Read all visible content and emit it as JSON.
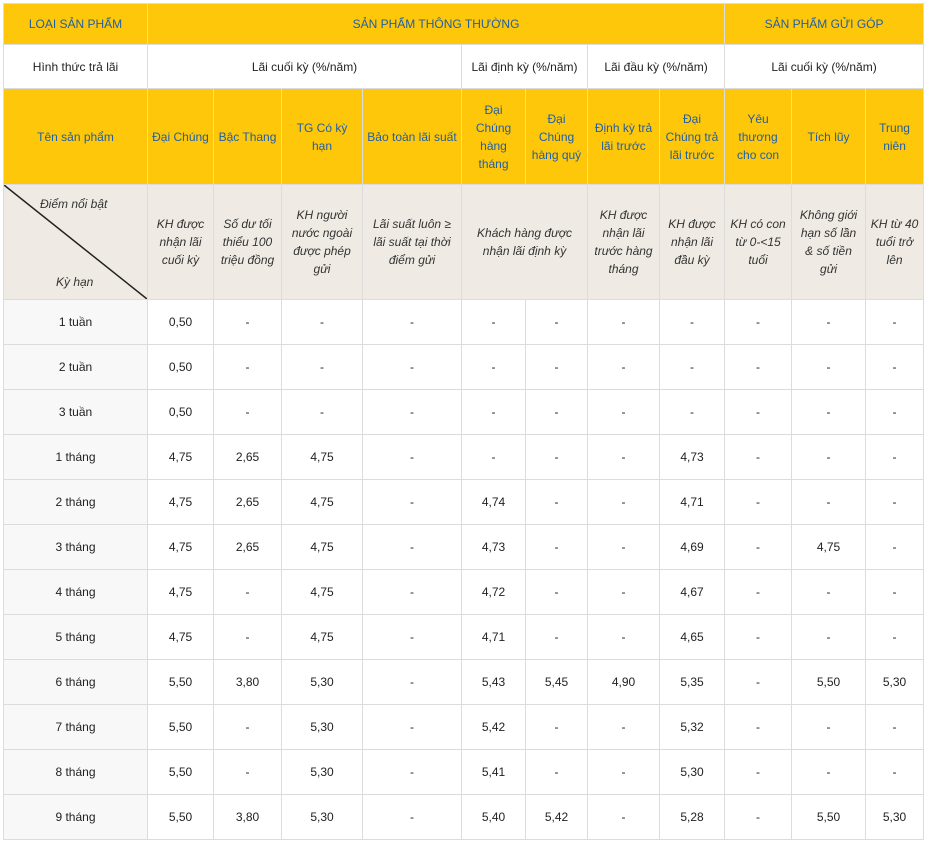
{
  "header": {
    "product_type_label": "LOẠI SẢN PHẨM",
    "group_regular": "SẢN PHẨM THÔNG THƯỜNG",
    "group_savings": "SẢN PHẨM GỬI GÓP",
    "payment_method_label": "Hình thức trả lãi",
    "pay_end": "Lãi cuối kỳ (%/năm)",
    "pay_periodic": "Lãi định kỳ (%/năm)",
    "pay_upfront": "Lãi đầu kỳ (%/năm)",
    "pay_end_savings": "Lãi cuối kỳ (%/năm)",
    "product_name_label": "Tên sản phẩm",
    "highlight_label": "Điểm nổi bật",
    "term_label": "Kỳ hạn",
    "products": [
      "Đại Chúng",
      "Bậc Thang",
      "TG Có kỳ hạn",
      "Bảo toàn lãi suất",
      "Đại Chúng hàng tháng",
      "Đại Chúng hàng quý",
      "Định kỳ trả lãi trước",
      "Đại Chúng trả lãi trước",
      "Yêu thương cho con",
      "Tích lũy",
      "Trung niên"
    ],
    "highlights": [
      "KH được nhận lãi cuối kỳ",
      "Số dư tối thiểu 100 triệu đồng",
      "KH người nước ngoài được phép gửi",
      "Lãi suất luôn ≥ lãi suất tại thời điểm gửi",
      "Khách hàng được nhận lãi định kỳ",
      "KH được nhận lãi trước hàng tháng",
      "KH được nhận lãi đầu kỳ",
      "KH có con từ 0-<15 tuổi",
      "Không giới hạn số lần & số tiền gửi",
      "KH từ 40 tuổi trở lên"
    ]
  },
  "rows": [
    {
      "term": "1 tuần",
      "values": [
        "0,50",
        "-",
        "-",
        "-",
        "-",
        "-",
        "-",
        "-",
        "-",
        "-",
        "-"
      ]
    },
    {
      "term": "2 tuần",
      "values": [
        "0,50",
        "-",
        "-",
        "-",
        "-",
        "-",
        "-",
        "-",
        "-",
        "-",
        "-"
      ]
    },
    {
      "term": "3 tuần",
      "values": [
        "0,50",
        "-",
        "-",
        "-",
        "-",
        "-",
        "-",
        "-",
        "-",
        "-",
        "-"
      ]
    },
    {
      "term": "1 tháng",
      "values": [
        "4,75",
        "2,65",
        "4,75",
        "-",
        "-",
        "-",
        "-",
        "4,73",
        "-",
        "-",
        "-"
      ]
    },
    {
      "term": "2 tháng",
      "values": [
        "4,75",
        "2,65",
        "4,75",
        "-",
        "4,74",
        "-",
        "-",
        "4,71",
        "-",
        "-",
        "-"
      ]
    },
    {
      "term": "3 tháng",
      "values": [
        "4,75",
        "2,65",
        "4,75",
        "-",
        "4,73",
        "-",
        "-",
        "4,69",
        "-",
        "4,75",
        "-"
      ]
    },
    {
      "term": "4 tháng",
      "values": [
        "4,75",
        "-",
        "4,75",
        "-",
        "4,72",
        "-",
        "-",
        "4,67",
        "-",
        "-",
        "-"
      ]
    },
    {
      "term": "5 tháng",
      "values": [
        "4,75",
        "-",
        "4,75",
        "-",
        "4,71",
        "-",
        "-",
        "4,65",
        "-",
        "-",
        "-"
      ]
    },
    {
      "term": "6 tháng",
      "values": [
        "5,50",
        "3,80",
        "5,30",
        "-",
        "5,43",
        "5,45",
        "4,90",
        "5,35",
        "-",
        "5,50",
        "5,30"
      ]
    },
    {
      "term": "7 tháng",
      "values": [
        "5,50",
        "-",
        "5,30",
        "-",
        "5,42",
        "-",
        "-",
        "5,32",
        "-",
        "-",
        "-"
      ]
    },
    {
      "term": "8 tháng",
      "values": [
        "5,50",
        "-",
        "5,30",
        "-",
        "5,41",
        "-",
        "-",
        "5,30",
        "-",
        "-",
        "-"
      ]
    },
    {
      "term": "9 tháng",
      "values": [
        "5,50",
        "3,80",
        "5,30",
        "-",
        "5,40",
        "5,42",
        "-",
        "5,28",
        "-",
        "5,50",
        "5,30"
      ]
    }
  ],
  "colors": {
    "header_bg": "#ffc709",
    "header_text": "#1f5fa6",
    "highlight_bg": "#efebe4"
  }
}
